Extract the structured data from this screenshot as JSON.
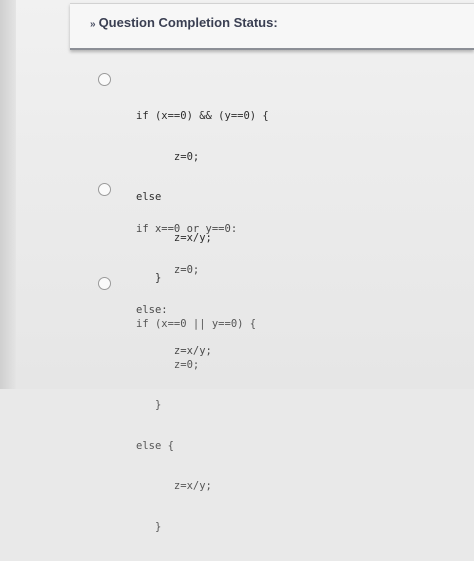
{
  "header": {
    "chevron": "»",
    "title": "Question Completion Status:"
  },
  "options": [
    {
      "lines": [
        "if (x==0) && (y==0) {",
        "      z=0;",
        "else",
        "      z=x/y;",
        "   }"
      ]
    },
    {
      "lines": [
        "if x==0 or y==0:",
        "      z=0;",
        "else:",
        "      z=x/y;"
      ]
    },
    {
      "lines": [
        "if (x==0 || y==0) {",
        "      z=0;",
        "   }",
        "else {",
        "      z=x/y;",
        "   }"
      ]
    }
  ]
}
